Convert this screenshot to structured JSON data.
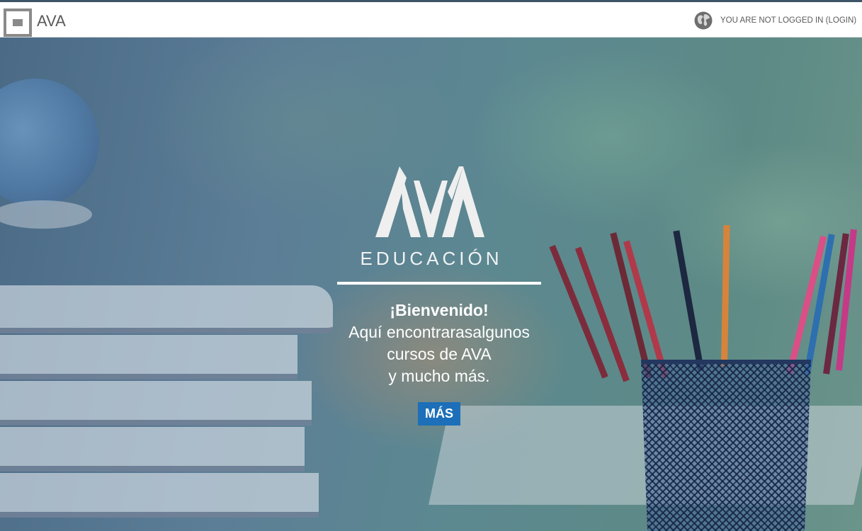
{
  "header": {
    "brand": "AVA",
    "login_status": "YOU ARE NOT LOGGED IN (LOGIN)"
  },
  "hero": {
    "logo_text": "EDUCACIÓN",
    "welcome_title": "¡Bienvenido!",
    "welcome_line_1": "Aquí encontrarasalgunos",
    "welcome_line_2": "cursos de AVA",
    "welcome_line_3": "y mucho más.",
    "button_label": "MÁS"
  },
  "colors": {
    "button": "#1c6fb8",
    "header_bg": "#ffffff",
    "header_text": "#5a5a5a"
  },
  "icons": {
    "menu": "menu-toggle-icon",
    "language": "globe-icon"
  }
}
